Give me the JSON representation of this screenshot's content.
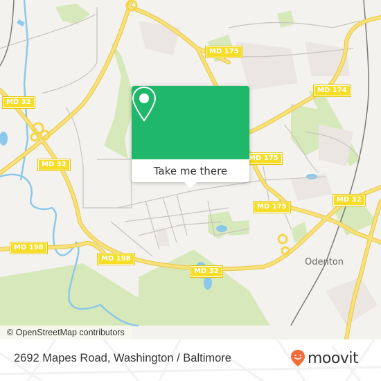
{
  "map": {
    "road_labels": [
      "MD 175",
      "MD 174",
      "MD 32",
      "MD 32",
      "MD 175",
      "MD 175",
      "MD 32",
      "MD 32",
      "MD 198",
      "MD 198",
      "MD 32"
    ],
    "place_labels": [
      "Odenton"
    ],
    "attribution": "© OpenStreetMap contributors",
    "colors": {
      "background": "#f3f2ee",
      "park": "#cfe6a8",
      "road_major": "#f7dc5e",
      "water": "#8cc8ea",
      "rail": "#777777"
    }
  },
  "popup": {
    "icon": "map-pin-icon",
    "button_label": "Take me there",
    "color": "#1fb86a"
  },
  "footer": {
    "address": "2692 Mapes Road, Washington / Baltimore",
    "brand": "moovit",
    "brand_color": "#f26b3a"
  }
}
